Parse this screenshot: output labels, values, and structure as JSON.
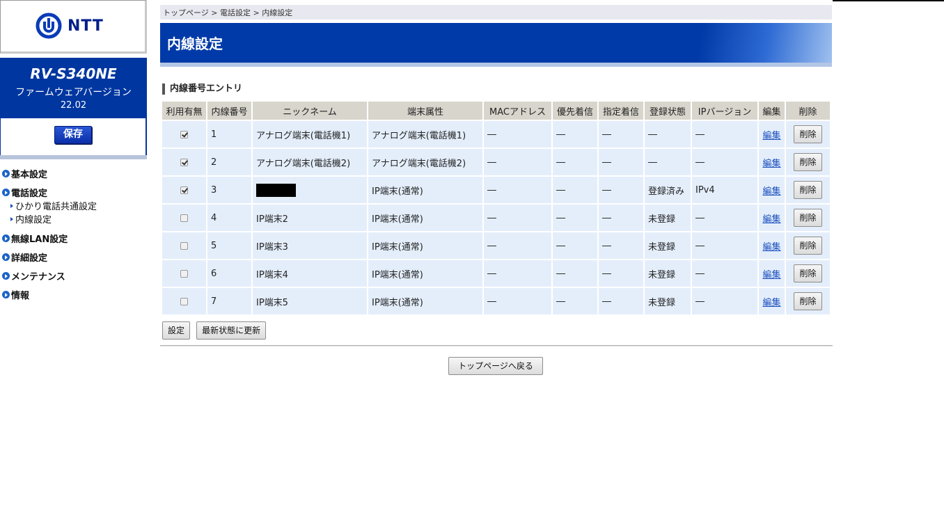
{
  "brand": {
    "logo_text": "NTT"
  },
  "device": {
    "model": "RV-S340NE",
    "firmware_label": "ファームウェアバージョン",
    "firmware_version": "22.02",
    "save_label": "保存"
  },
  "nav": {
    "items": [
      {
        "label": "基本設定"
      },
      {
        "label": "電話設定"
      },
      {
        "label": "無線LAN設定"
      },
      {
        "label": "詳細設定"
      },
      {
        "label": "メンテナンス"
      },
      {
        "label": "情報"
      }
    ],
    "subitems": [
      {
        "label": "ひかり電話共通設定"
      },
      {
        "label": "内線設定"
      }
    ]
  },
  "breadcrumb": {
    "items": [
      "トップページ",
      "電話設定",
      "内線設定"
    ],
    "separator": ">"
  },
  "page": {
    "title": "内線設定",
    "section_title": "内線番号エントリ"
  },
  "table": {
    "headers": [
      "利用有無",
      "内線番号",
      "ニックネーム",
      "端末属性",
      "MACアドレス",
      "優先着信",
      "指定着信",
      "登録状態",
      "IPバージョン",
      "編集",
      "削除"
    ],
    "rows": [
      {
        "enabled": true,
        "number": "1",
        "nickname": "アナログ端末(電話機1)",
        "nickname_masked": false,
        "attr": "アナログ端末(電話機1)",
        "mac": "―",
        "priority": "―",
        "designated": "―",
        "status": "―",
        "ipver": "―",
        "edit": "編集",
        "delete": "削除"
      },
      {
        "enabled": true,
        "number": "2",
        "nickname": "アナログ端末(電話機2)",
        "nickname_masked": false,
        "attr": "アナログ端末(電話機2)",
        "mac": "―",
        "priority": "―",
        "designated": "―",
        "status": "―",
        "ipver": "―",
        "edit": "編集",
        "delete": "削除"
      },
      {
        "enabled": true,
        "number": "3",
        "nickname": "",
        "nickname_masked": true,
        "attr": "IP端末(通常)",
        "mac": "―",
        "priority": "―",
        "designated": "―",
        "status": "登録済み",
        "ipver": "IPv4",
        "edit": "編集",
        "delete": "削除"
      },
      {
        "enabled": false,
        "number": "4",
        "nickname": "IP端末2",
        "nickname_masked": false,
        "attr": "IP端末(通常)",
        "mac": "―",
        "priority": "―",
        "designated": "―",
        "status": "未登録",
        "ipver": "―",
        "edit": "編集",
        "delete": "削除"
      },
      {
        "enabled": false,
        "number": "5",
        "nickname": "IP端末3",
        "nickname_masked": false,
        "attr": "IP端末(通常)",
        "mac": "―",
        "priority": "―",
        "designated": "―",
        "status": "未登録",
        "ipver": "―",
        "edit": "編集",
        "delete": "削除"
      },
      {
        "enabled": false,
        "number": "6",
        "nickname": "IP端末4",
        "nickname_masked": false,
        "attr": "IP端末(通常)",
        "mac": "―",
        "priority": "―",
        "designated": "―",
        "status": "未登録",
        "ipver": "―",
        "edit": "編集",
        "delete": "削除"
      },
      {
        "enabled": false,
        "number": "7",
        "nickname": "IP端末5",
        "nickname_masked": false,
        "attr": "IP端末(通常)",
        "mac": "―",
        "priority": "―",
        "designated": "―",
        "status": "未登録",
        "ipver": "―",
        "edit": "編集",
        "delete": "削除"
      }
    ]
  },
  "actions": {
    "set_label": "設定",
    "refresh_label": "最新状態に更新",
    "back_label": "トップページへ戻る"
  },
  "colors": {
    "brand_blue": "#0036a0",
    "header_blue": "#003aa8",
    "row_bg": "#e4eefb",
    "header_cell_bg": "#d8d5cc",
    "link": "#1a4fbf"
  }
}
